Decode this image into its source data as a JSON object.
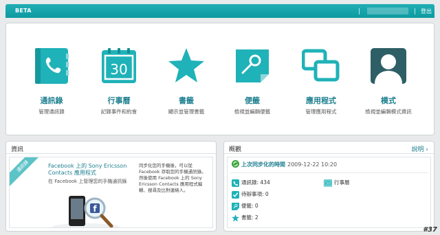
{
  "topbar": {
    "beta": "BETA",
    "logout": "登出"
  },
  "apps": [
    {
      "title": "通訊錄",
      "sub": "管理通訊錄",
      "icon": "phone-book-icon"
    },
    {
      "title": "行事曆",
      "sub": "記錄事件和約會",
      "icon": "calendar-icon",
      "day": "30"
    },
    {
      "title": "書籤",
      "sub": "顯示並管理書籤",
      "icon": "star-icon"
    },
    {
      "title": "便籤",
      "sub": "檢視並編輯便籤",
      "icon": "note-icon"
    },
    {
      "title": "應用程式",
      "sub": "管理應用程式",
      "icon": "apps-icon"
    },
    {
      "title": "模式",
      "sub": "檢視並編輯模式資訊",
      "icon": "profile-icon"
    }
  ],
  "news": {
    "heading": "資訊",
    "ribbon": "通訊錄",
    "title": "Facebook 上的 Sony Ericsson Contacts 應用程式",
    "subtitle": "在 Facebook 上管理您的手機通訊錄",
    "body": "同步化您的手機後，可以從 Facebook 存取您的手機通訊錄。然後使用 Facebook 上的 Sony Ericsson Contacts 應用程式編輯、搜尋及比對連絡人。"
  },
  "summary": {
    "heading": "概觀",
    "help": "說明",
    "sync_label": "上次同步化的時間",
    "sync_time": "2009-12-22 10:20",
    "contacts": "通訊錄: 434",
    "calendar": "行事曆",
    "calendar_day": "30",
    "tasks": "待辦事項: 0",
    "notes": "便籤: 0",
    "bookmarks": "書籤: 2"
  },
  "corner": "#37",
  "colors": {
    "accent": "#17a6ad",
    "link": "#1d7f8f"
  }
}
